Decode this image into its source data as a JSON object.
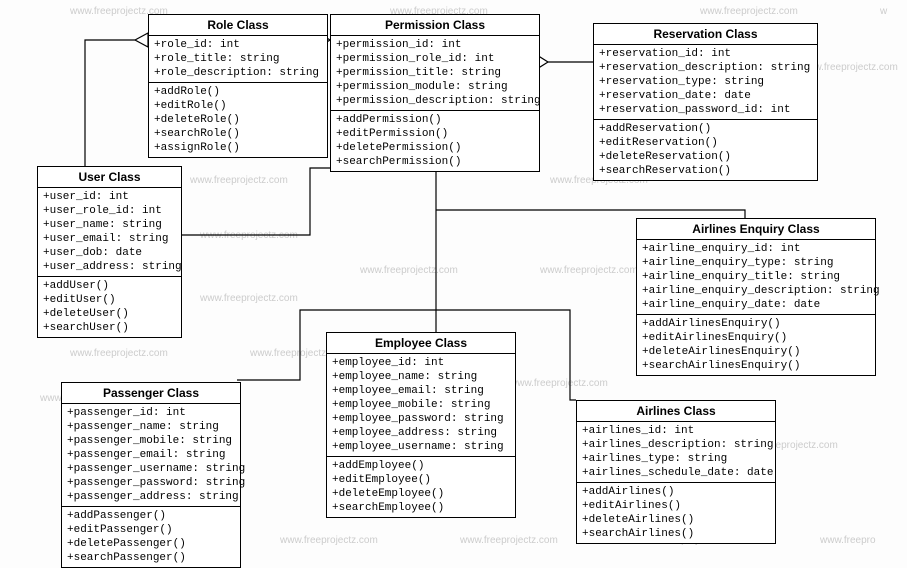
{
  "watermark_text": "www.freeprojectz.com",
  "classes": {
    "role": {
      "title": "Role Class",
      "attrs": [
        "+role_id: int",
        "+role_title: string",
        "+role_description: string"
      ],
      "ops": [
        "+addRole()",
        "+editRole()",
        "+deleteRole()",
        "+searchRole()",
        "+assignRole()"
      ]
    },
    "permission": {
      "title": "Permission Class",
      "attrs": [
        "+permission_id: int",
        "+permission_role_id: int",
        "+permission_title: string",
        "+permission_module: string",
        "+permission_description: string"
      ],
      "ops": [
        "+addPermission()",
        "+editPermission()",
        "+deletePermission()",
        "+searchPermission()"
      ]
    },
    "reservation": {
      "title": "Reservation Class",
      "attrs": [
        "+reservation_id: int",
        "+reservation_description: string",
        "+reservation_type: string",
        "+reservation_date: date",
        "+reservation_password_id: int"
      ],
      "ops": [
        "+addReservation()",
        "+editReservation()",
        "+deleteReservation()",
        "+searchReservation()"
      ]
    },
    "user": {
      "title": "User Class",
      "attrs": [
        "+user_id: int",
        "+user_role_id: int",
        "+user_name: string",
        "+user_email: string",
        "+user_dob: date",
        "+user_address: string"
      ],
      "ops": [
        "+addUser()",
        "+editUser()",
        "+deleteUser()",
        "+searchUser()"
      ]
    },
    "enquiry": {
      "title": "Airlines Enquiry Class",
      "attrs": [
        "+airline_enquiry_id: int",
        "+airline_enquiry_type: string",
        "+airline_enquiry_title: string",
        "+airline_enquiry_description: string",
        "+airline_enquiry_date: date"
      ],
      "ops": [
        "+addAirlinesEnquiry()",
        "+editAirlinesEnquiry()",
        "+deleteAirlinesEnquiry()",
        "+searchAirlinesEnquiry()"
      ]
    },
    "passenger": {
      "title": "Passenger Class",
      "attrs": [
        "+passenger_id: int",
        "+passenger_name: string",
        "+passenger_mobile: string",
        "+passenger_email: string",
        "+passenger_username: string",
        "+passenger_password: string",
        "+passenger_address: string"
      ],
      "ops": [
        "+addPassenger()",
        "+editPassenger()",
        "+deletePassenger()",
        "+searchPassenger()"
      ]
    },
    "employee": {
      "title": "Employee Class",
      "attrs": [
        "+employee_id: int",
        "+employee_name: string",
        "+employee_email: string",
        "+employee_mobile: string",
        "+employee_password: string",
        "+employee_address: string",
        "+employee_username: string"
      ],
      "ops": [
        "+addEmployee()",
        "+editEmployee()",
        "+deleteEmployee()",
        "+searchEmployee()"
      ]
    },
    "airlines": {
      "title": "Airlines Class",
      "attrs": [
        "+airlines_id: int",
        "+airlines_description: string",
        "+airlines_type: string",
        "+airlines_schedule_date: date"
      ],
      "ops": [
        "+addAirlines()",
        "+editAirlines()",
        "+deleteAirlines()",
        "+searchAirlines()"
      ]
    }
  },
  "chart_data": {
    "type": "uml-class-diagram",
    "classes": [
      "Role Class",
      "Permission Class",
      "Reservation Class",
      "User Class",
      "Airlines Enquiry Class",
      "Passenger Class",
      "Employee Class",
      "Airlines Class"
    ],
    "relationships": [
      {
        "from": "User Class",
        "to": "Role Class",
        "kind": "generalization"
      },
      {
        "from": "Role Class",
        "to": "Permission Class",
        "kind": "aggregation"
      },
      {
        "from": "Permission Class",
        "to": "Reservation Class",
        "kind": "aggregation"
      },
      {
        "from": "User Class",
        "to": "Permission Class",
        "kind": "association"
      },
      {
        "from": "Permission Class",
        "to": "Airlines Enquiry Class",
        "kind": "association"
      },
      {
        "from": "Permission Class",
        "to": "Employee Class",
        "kind": "association"
      },
      {
        "from": "Permission Class",
        "to": "Airlines Class",
        "kind": "association"
      },
      {
        "from": "Permission Class",
        "to": "Passenger Class",
        "kind": "association"
      }
    ]
  }
}
